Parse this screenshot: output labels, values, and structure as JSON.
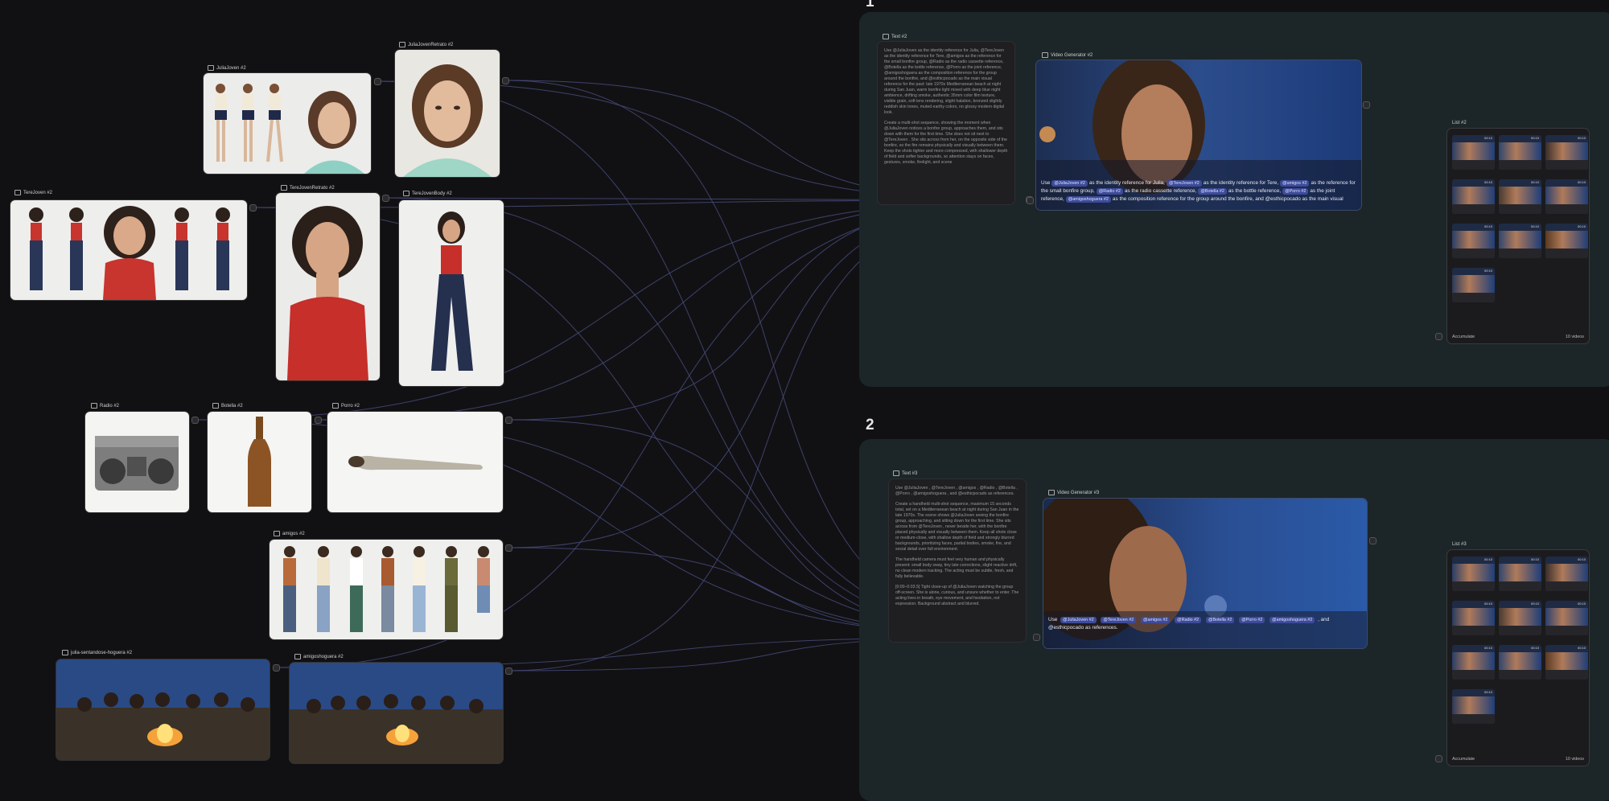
{
  "groups": [
    {
      "label": "1"
    },
    {
      "label": "2"
    }
  ],
  "nodes": {
    "julia_joven": "JuliaJoven #2",
    "julia_rostro": "JuliaJovenRetrato #2",
    "tere_joven": "TereJoven #2",
    "tere_rostro": "TereJovenRetrato #2",
    "tere_body": "TereJovenBody #2",
    "radio": "Radio #2",
    "botella": "Botella #2",
    "porro": "Porro #2",
    "amigos": "amigos #2",
    "julia_hoguera": "julia-sentandose-hoguera #2",
    "amigos_hoguera": "amigoshoguera #2",
    "text1": "Text #2",
    "video1": "Video Generator #2",
    "list1": "List #2",
    "text2": "Text #3",
    "video2": "Video Generator #3",
    "list2": "List #3"
  },
  "text1": {
    "p1": "Use @JuliaJoven as the identity reference for Julia, @TereJoven as the identity reference for Tere, @amigos as the reference for the small bonfire group, @Radio as the radio cassette reference, @Botella as the bottle reference, @Porro as the joint reference, @amigoshoguera as the composition reference for the group around the bonfire, and @esthicpocado as the main visual reference for the past: late 1970s Mediterranean beach at night during San Juan, warm bonfire light mixed with deep blue night ambience, drifting smoke, authentic 35mm color film texture, visible grain, soft lens rendering, slight halation, bronzed slightly reddish skin tones, muted earthy colors, no glossy modern digital look.",
    "p2": "Create a multi-shot sequence, showing the moment when @JuliaJoven notices a bonfire group, approaches them, and sits down with them for the first time. She does not sit next to @TereJoven . She sits across from her, on the opposite side of the bonfire, so the fire remains physically and visually between them. Keep the shots tighter and more compressed, with shallower depth of field and softer backgrounds, so attention stays on faces, gestures, smoke, firelight, and scene"
  },
  "video1": {
    "c1": "Use",
    "chip1": "@JuliaJoven #2",
    "c2": "as the identity reference for Julia,",
    "chip2": "@TereJoven #2",
    "c3": "as the identity reference for Tere,",
    "chip3": "@amigos #2",
    "c4": "as the reference for the small bonfire group,",
    "chip4": "@Radio #2",
    "c5": "as the radio cassette reference,",
    "chip5": "@Botella #2",
    "c6": "as the bottle reference,",
    "chip6": "@Porro #2",
    "c7": "as the joint reference,",
    "chip7": "@amigoshoguera #2",
    "c8": "as the composition reference for the group around the bonfire, and @esthicpocado as the main visual"
  },
  "text2": {
    "p1": "Use @JuliaJoven , @TereJoven , @amigos , @Radio , @Botella , @Porro , @amigoshoguera , and @esthicpocado as references.",
    "p2": "Create a handheld multi-shot sequence, maximum 15 seconds total, set on a Mediterranean beach at night during San Juan in the late 1970s. The scene shows @JuliaJoven seeing the bonfire group, approaching, and sitting down for the first time. She sits across from @TereJoven , never beside her, with the bonfire placed physically and visually between them. Keep all shots close or medium-close, with shallow depth of field and strongly blurred backgrounds, prioritizing faces, partial bodies, smoke, fire, and social detail over full environment.",
    "p3": "The handheld camera must feel very human and physically present: small body sway, tiny late corrections, slight reactive drift, no clean modern tracking. The acting must be subtle, fresh, and fully believable.",
    "p4": "[0:00–0:03.5] Tight close-up of @JuliaJoven watching the group off-screen. She is alone, curious, and unsure whether to enter. The acting lives in breath, eye movement, and hesitation, not expression. Background abstract and blurred."
  },
  "video2": {
    "c1": "Use",
    "chips": [
      "@JuliaJoven #2",
      "@TereJoven #2",
      "@amigos #2",
      "@Radio #2",
      "@Botella #2",
      "@Porro #2",
      "@amigoshoguera #2"
    ],
    "c2": ", and @esthicpocado as",
    "c3": "references."
  },
  "list1": {
    "durations": [
      "00:10",
      "00:10",
      "00:10",
      "00:10",
      "00:10",
      "00:10",
      "00:10",
      "00:10",
      "00:10",
      "00:10"
    ],
    "footer_left": "Accumulate",
    "footer_right": "10 videos"
  },
  "list2": {
    "durations": [
      "00:10",
      "00:10",
      "00:10",
      "00:10",
      "00:10",
      "00:10",
      "00:10",
      "00:10",
      "00:10",
      "00:10"
    ],
    "footer_left": "Accumulate",
    "footer_right": "10 videos"
  },
  "colors": {
    "background": "#111114",
    "group": "#1c2628",
    "wire": "#4a4f80",
    "chip": "#3d4b9a"
  }
}
